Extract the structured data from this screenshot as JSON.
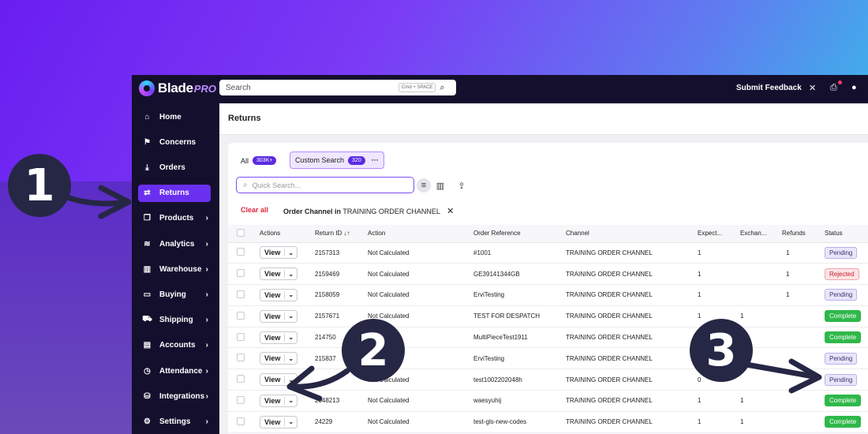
{
  "app": {
    "logo_text": "Blade",
    "logo_suffix": "PRO",
    "search_placeholder": "Search",
    "search_shortcut": "Cmd + SPACE",
    "submit_feedback": "Submit Feedback"
  },
  "sidebar": {
    "items": [
      {
        "label": "Home",
        "icon": "home-icon",
        "glyph": "⌂",
        "chevron": false,
        "active": false
      },
      {
        "label": "Concerns",
        "icon": "flag-icon",
        "glyph": "⚑",
        "chevron": false,
        "active": false
      },
      {
        "label": "Orders",
        "icon": "download-tray-icon",
        "glyph": "⤓",
        "chevron": false,
        "active": false
      },
      {
        "label": "Returns",
        "icon": "swap-arrows-icon",
        "glyph": "⇄",
        "chevron": false,
        "active": true
      },
      {
        "label": "Products",
        "icon": "box-icon",
        "glyph": "❒",
        "chevron": true,
        "active": false
      },
      {
        "label": "Analytics",
        "icon": "chart-icon",
        "glyph": "≋",
        "chevron": true,
        "active": false
      },
      {
        "label": "Warehouse",
        "icon": "warehouse-icon",
        "glyph": "▥",
        "chevron": true,
        "active": false
      },
      {
        "label": "Buying",
        "icon": "card-icon",
        "glyph": "▭",
        "chevron": true,
        "active": false
      },
      {
        "label": "Shipping",
        "icon": "truck-icon",
        "glyph": "⛟",
        "chevron": true,
        "active": false
      },
      {
        "label": "Accounts",
        "icon": "book-icon",
        "glyph": "▤",
        "chevron": true,
        "active": false
      },
      {
        "label": "Attendance",
        "icon": "clock-icon",
        "glyph": "◷",
        "chevron": true,
        "active": false
      },
      {
        "label": "Integrations",
        "icon": "database-icon",
        "glyph": "⛁",
        "chevron": true,
        "active": false
      },
      {
        "label": "Settings",
        "icon": "gear-icon",
        "glyph": "⚙",
        "chevron": true,
        "active": false
      }
    ]
  },
  "page": {
    "title": "Returns",
    "tab_all_label": "All",
    "tab_all_count": "303K+",
    "tab_custom_label": "Custom Search",
    "tab_custom_count": "320",
    "tab_more": "···",
    "quick_search_placeholder": "Quick Search...",
    "clear_all": "Clear all",
    "filter_field": "Order Channel in",
    "filter_value": "TRAINING ORDER CHANNEL"
  },
  "table": {
    "columns": [
      "Actions",
      "Return ID ↓↑",
      "Action",
      "Order Reference",
      "Channel",
      "Expect...",
      "Exchan...",
      "Refunds",
      "Status"
    ],
    "view_label": "View",
    "rows": [
      {
        "id": "2157313",
        "action": "Not Calculated",
        "order_ref": "#1001",
        "channel": "TRAINING ORDER CHANNEL",
        "expected": "1",
        "exchanges": "",
        "refunds": "1",
        "status": "Pending",
        "status_type": "pending"
      },
      {
        "id": "2159469",
        "action": "Not Calculated",
        "order_ref": "GE39141344GB",
        "channel": "TRAINING ORDER CHANNEL",
        "expected": "1",
        "exchanges": "",
        "refunds": "1",
        "status": "Rejected",
        "status_type": "rejected"
      },
      {
        "id": "2158059",
        "action": "Not Calculated",
        "order_ref": "ErviTesting",
        "channel": "TRAINING ORDER CHANNEL",
        "expected": "1",
        "exchanges": "",
        "refunds": "1",
        "status": "Pending",
        "status_type": "pending"
      },
      {
        "id": "2157671",
        "action": "Not Calculated",
        "order_ref": "TEST FOR DESPATCH",
        "channel": "TRAINING ORDER CHANNEL",
        "expected": "1",
        "exchanges": "1",
        "refunds": "",
        "status": "Complete",
        "status_type": "complete"
      },
      {
        "id": "214750",
        "action": "",
        "order_ref": "MultiPieceTest1911",
        "channel": "TRAINING ORDER CHANNEL",
        "expected": "",
        "exchanges": "",
        "refunds": "",
        "status": "Complete",
        "status_type": "complete"
      },
      {
        "id": "215837",
        "action": "",
        "order_ref": "ErviTesting",
        "channel": "TRAINING ORDER CHANNEL",
        "expected": "",
        "exchanges": "",
        "refunds": "",
        "status": "Pending",
        "status_type": "pending"
      },
      {
        "id": "",
        "action": "Not Calculated",
        "order_ref": "test1002202048h",
        "channel": "TRAINING ORDER CHANNEL",
        "expected": "0",
        "exchanges": "",
        "refunds": "",
        "status": "Pending",
        "status_type": "pending"
      },
      {
        "id": "2048213",
        "action": "Not Calculated",
        "order_ref": "waesyuhij",
        "channel": "TRAINING ORDER CHANNEL",
        "expected": "1",
        "exchanges": "1",
        "refunds": "",
        "status": "Complete",
        "status_type": "complete"
      },
      {
        "id": "24229",
        "action": "Not Calculated",
        "order_ref": "test-gls-new-codes",
        "channel": "TRAINING ORDER CHANNEL",
        "expected": "1",
        "exchanges": "1",
        "refunds": "",
        "status": "Complete",
        "status_type": "complete"
      }
    ]
  },
  "callouts": {
    "one": "1",
    "two": "2",
    "three": "3"
  },
  "colors": {
    "sidebar_bg": "#150f2e",
    "accent": "#6a30f0",
    "pending": "#e9e6fb",
    "rejected": "#fde4e6",
    "complete": "#2fb84a",
    "callout": "#262744"
  }
}
